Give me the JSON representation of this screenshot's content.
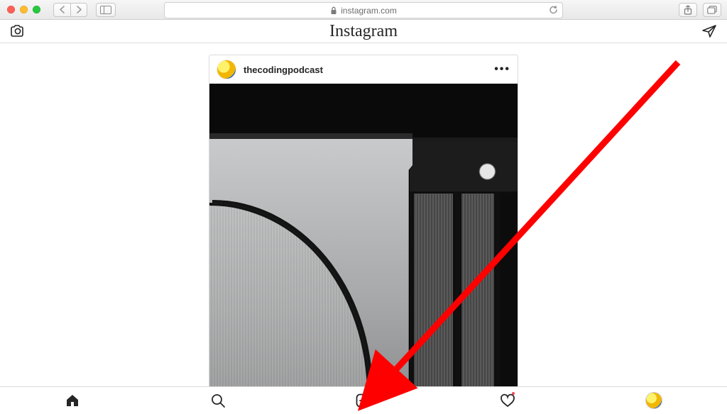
{
  "browser": {
    "url_host": "instagram.com"
  },
  "app": {
    "name": "Instagram"
  },
  "post": {
    "username": "thecodingpodcast",
    "more_label": "•••"
  },
  "bottom_nav": {
    "notification_indicator": true
  }
}
